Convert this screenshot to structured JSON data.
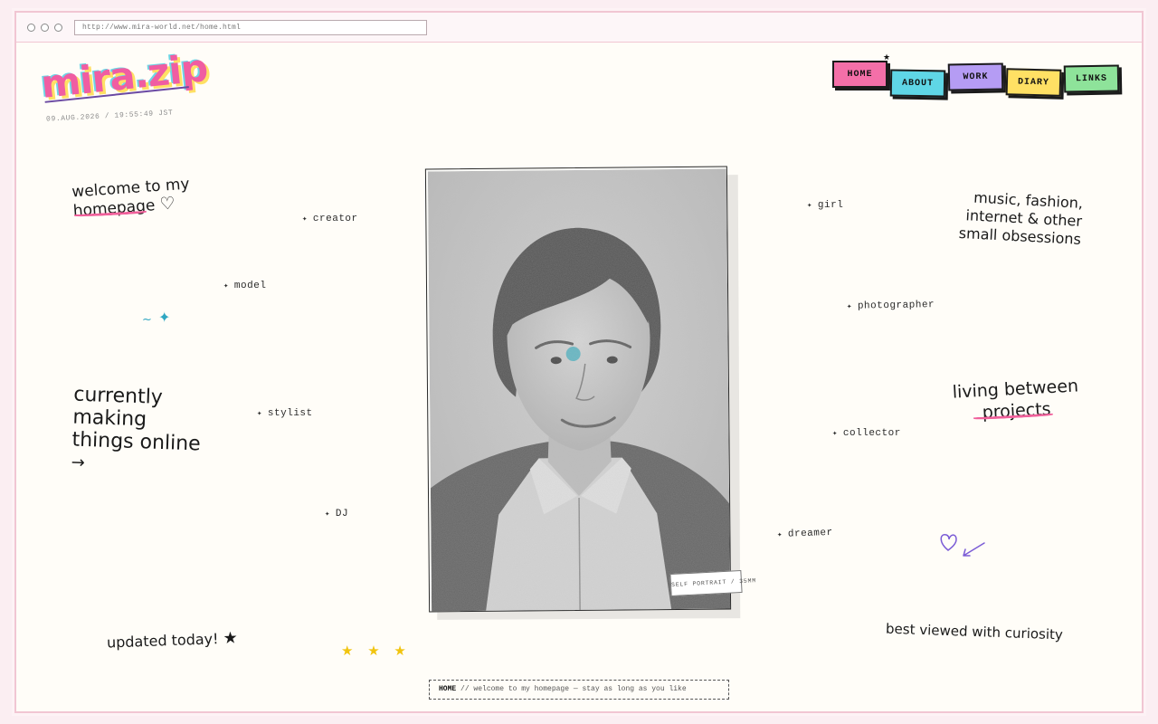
{
  "browser": {
    "url": "http://www.mira-world.net/home.html"
  },
  "site": {
    "logo": "mira.zip",
    "datetime": "09.AUG.2026 / 19:55:49 JST"
  },
  "nav": {
    "home": "HOME",
    "about": "ABOUT",
    "work": "WORK",
    "diary": "DIARY",
    "links": "LINKS"
  },
  "colors": {
    "home": "#f46fa8",
    "about": "#5fd6e6",
    "work": "#b59cf4",
    "diary": "#ffe064",
    "links": "#8ee39a"
  },
  "text": {
    "welcome_line1": "welcome to my",
    "welcome_line2": "homepage",
    "heart": "♡",
    "currently_1": "currently",
    "currently_2": "making",
    "currently_3": "things online",
    "arrow": "→",
    "updated": "updated today!",
    "updated_star": "★",
    "music_1": "music, fashion,",
    "music_2": "internet & other",
    "music_3": "small obsessions",
    "living_1": "living between",
    "living_2": "projects",
    "best_viewed": "best viewed with curiosity"
  },
  "roles_left": [
    "creator",
    "model",
    "stylist",
    "DJ"
  ],
  "roles_right": [
    "girl",
    "photographer",
    "collector",
    "dreamer"
  ],
  "photo": {
    "caption": "SELF PORTRAIT / 35MM"
  },
  "footer": {
    "current": "HOME",
    "message": "// welcome to my homepage — stay as long as you like"
  },
  "decor": {
    "yellow_stars": "★ ★ ★",
    "spark": "✦",
    "teal_star": "✦"
  }
}
